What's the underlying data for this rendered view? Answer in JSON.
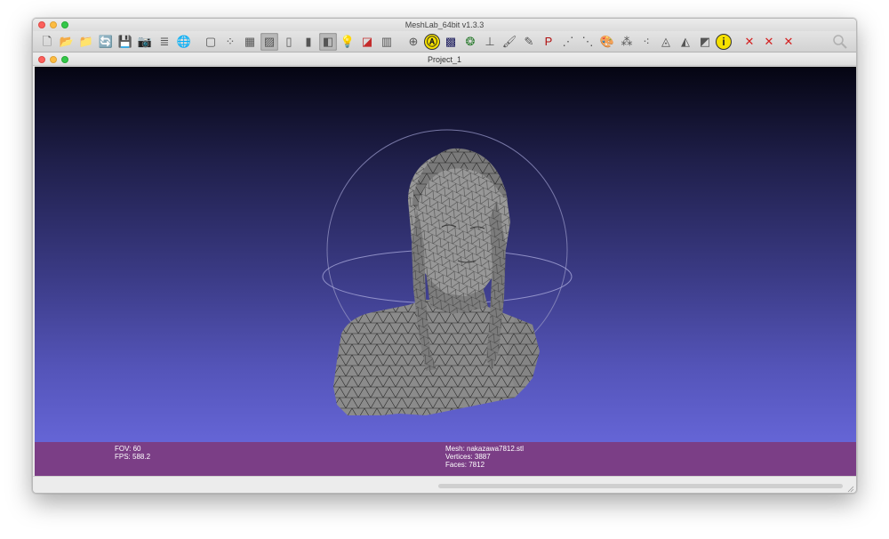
{
  "app": {
    "window_title": "MeshLab_64bit v1.3.3",
    "document_title": "Project_1"
  },
  "toolbar": {
    "buttons": [
      {
        "name": "new-document-icon",
        "glyph": "🗋"
      },
      {
        "name": "open-folder-icon",
        "glyph": "📂"
      },
      {
        "name": "open-project-icon",
        "glyph": "📁"
      },
      {
        "name": "reload-icon",
        "glyph": "🔄"
      },
      {
        "name": "save-icon",
        "glyph": "💾"
      },
      {
        "name": "snapshot-icon",
        "glyph": "📷"
      },
      {
        "name": "layers-icon",
        "glyph": "≣"
      },
      {
        "name": "globe-icon",
        "glyph": "🌐"
      },
      {
        "name": "bounding-box-icon",
        "glyph": "▢"
      },
      {
        "name": "points-icon",
        "glyph": "⁘"
      },
      {
        "name": "wireframe-icon",
        "glyph": "▦"
      },
      {
        "name": "hidden-lines-icon",
        "glyph": "▨",
        "active": true
      },
      {
        "name": "flat-lines-icon",
        "glyph": "▯"
      },
      {
        "name": "flat-icon",
        "glyph": "▮"
      },
      {
        "name": "smooth-icon",
        "glyph": "◧",
        "active": true
      },
      {
        "name": "light-bulb-icon",
        "glyph": "💡"
      },
      {
        "name": "double-side-icon",
        "glyph": "◪"
      },
      {
        "name": "fancy-lighting-icon",
        "glyph": "▥"
      },
      {
        "name": "trackball-icon",
        "glyph": "⊕"
      },
      {
        "name": "annotation-icon",
        "glyph": "Ⓐ"
      },
      {
        "name": "texture-icon",
        "glyph": "▩"
      },
      {
        "name": "radiance-icon",
        "glyph": "❂"
      },
      {
        "name": "axis-icon",
        "glyph": "⊥"
      },
      {
        "name": "paint-icon",
        "glyph": "🖌"
      },
      {
        "name": "brush-icon",
        "glyph": "✎"
      },
      {
        "name": "pick-points-icon",
        "glyph": "P"
      },
      {
        "name": "measure-icon",
        "glyph": "⋰"
      },
      {
        "name": "align-icon",
        "glyph": "⋱"
      },
      {
        "name": "color-icon",
        "glyph": "🎨"
      },
      {
        "name": "reference-icon",
        "glyph": "⁂"
      },
      {
        "name": "select-vertex-icon",
        "glyph": "⁖"
      },
      {
        "name": "select-faces-icon",
        "glyph": "◬"
      },
      {
        "name": "select-connected-icon",
        "glyph": "◭"
      },
      {
        "name": "gradient-icon",
        "glyph": "◩"
      },
      {
        "name": "info-icon",
        "glyph": "i"
      },
      {
        "name": "delete-vertices-icon",
        "glyph": "✕"
      },
      {
        "name": "delete-faces-icon",
        "glyph": "✕"
      },
      {
        "name": "delete-all-icon",
        "glyph": "✕"
      }
    ],
    "search_icon": "magnifier-icon"
  },
  "info": {
    "fov": "FOV: 60",
    "fps": "FPS:   588.2",
    "mesh": "Mesh: nakazawa7812.stl",
    "vertices": "Vertices: 3887",
    "faces": "Faces: 7812"
  },
  "colors": {
    "viewport_top": "#050512",
    "viewport_bottom": "#6565d6",
    "info_bar": "#7b3e86",
    "mesh_fill": "#8a8a8a"
  }
}
